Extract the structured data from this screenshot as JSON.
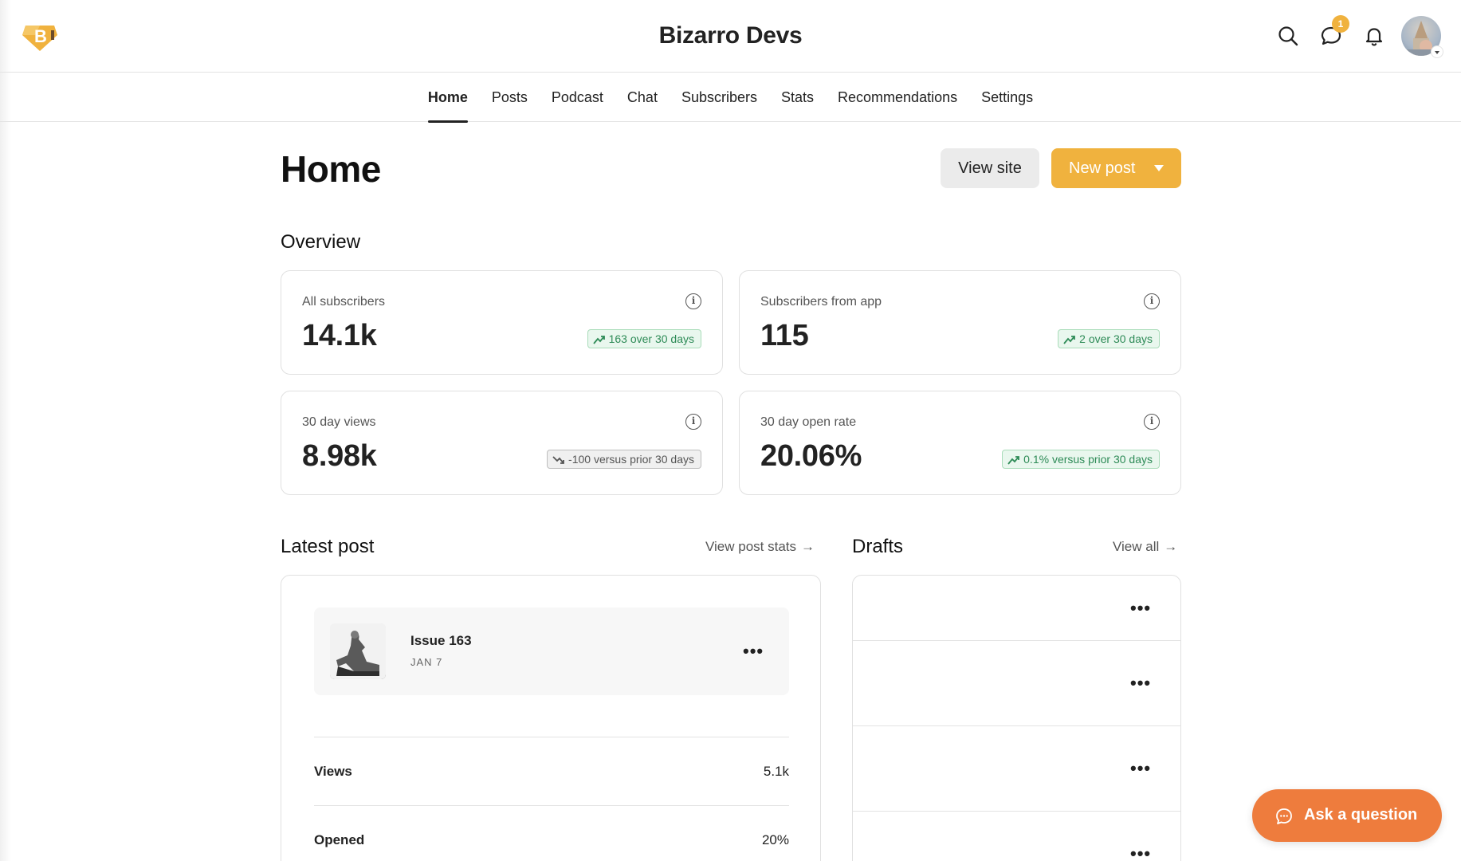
{
  "header": {
    "site_title": "Bizarro Devs",
    "logo_letter": "B",
    "messages_badge": "1",
    "icons": [
      "search-icon",
      "chat-icon",
      "bell-icon"
    ]
  },
  "nav": {
    "items": [
      {
        "label": "Home",
        "active": true
      },
      {
        "label": "Posts"
      },
      {
        "label": "Podcast"
      },
      {
        "label": "Chat"
      },
      {
        "label": "Subscribers"
      },
      {
        "label": "Stats"
      },
      {
        "label": "Recommendations"
      },
      {
        "label": "Settings"
      }
    ]
  },
  "page": {
    "title": "Home",
    "view_site_label": "View site",
    "new_post_label": "New post"
  },
  "overview": {
    "title": "Overview",
    "cards": [
      {
        "label": "All subscribers",
        "value": "14.1k",
        "trend": "163 over 30 days",
        "trend_dir": "up"
      },
      {
        "label": "Subscribers from app",
        "value": "115",
        "trend": "2 over 30 days",
        "trend_dir": "up"
      },
      {
        "label": "30 day views",
        "value": "8.98k",
        "trend": "-100 versus prior 30 days",
        "trend_dir": "down"
      },
      {
        "label": "30 day open rate",
        "value": "20.06%",
        "trend": "0.1% versus prior 30 days",
        "trend_dir": "up"
      }
    ]
  },
  "latest_post": {
    "title": "Latest post",
    "link_label": "View post stats",
    "post": {
      "title": "Issue 163",
      "date": "JAN 7"
    },
    "metrics": [
      {
        "label": "Views",
        "value": "5.1k"
      },
      {
        "label": "Opened",
        "value": "20%"
      }
    ]
  },
  "drafts": {
    "title": "Drafts",
    "link_label": "View all",
    "count_visible": 4
  },
  "ask": {
    "label": "Ask a question"
  },
  "colors": {
    "accent": "#f0b23e",
    "ask_button": "#ee7c3d",
    "trend_up": "#2e8b57",
    "border": "#e0e0e0"
  }
}
